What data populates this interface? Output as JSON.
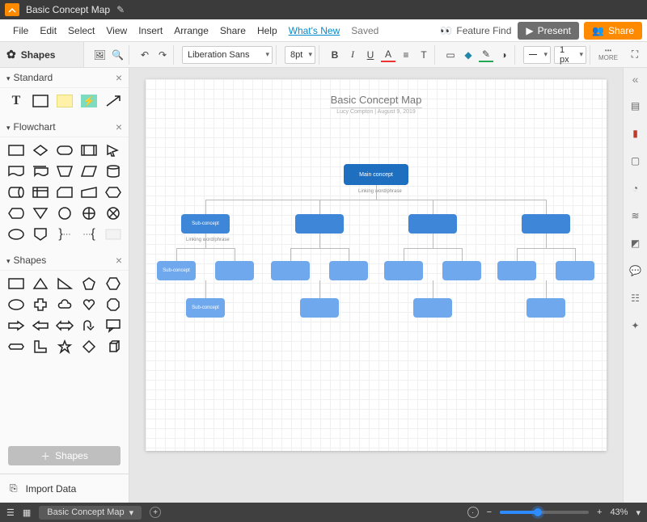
{
  "title": "Basic Concept Map",
  "menubar": {
    "items": [
      "File",
      "Edit",
      "Select",
      "View",
      "Insert",
      "Arrange",
      "Share",
      "Help"
    ],
    "whats_new": "What's New",
    "saved": "Saved",
    "feature_find": "Feature Find",
    "present": "Present",
    "share": "Share"
  },
  "toolbar": {
    "font": "Liberation Sans",
    "font_size": "8pt",
    "line_width": "1 px",
    "more": "MORE"
  },
  "shapes_panel": {
    "header": "Shapes",
    "sections": {
      "standard": "Standard",
      "flowchart": "Flowchart",
      "shapes": "Shapes"
    },
    "add_shapes": "Shapes",
    "import_data": "Import Data"
  },
  "canvas": {
    "doc_title": "Basic Concept Map",
    "doc_sub": "Lucy Compton  |  August 9, 2019",
    "main_concept": "Main concept",
    "linking": "Linking word/phrase",
    "sub_concept": "Sub-concept",
    "linking2": "Linking word/phrase",
    "sub_concept2": "Sub-concept",
    "sub_concept3": "Sub-concept"
  },
  "statusbar": {
    "tab": "Basic Concept Map",
    "zoom": "43%"
  }
}
